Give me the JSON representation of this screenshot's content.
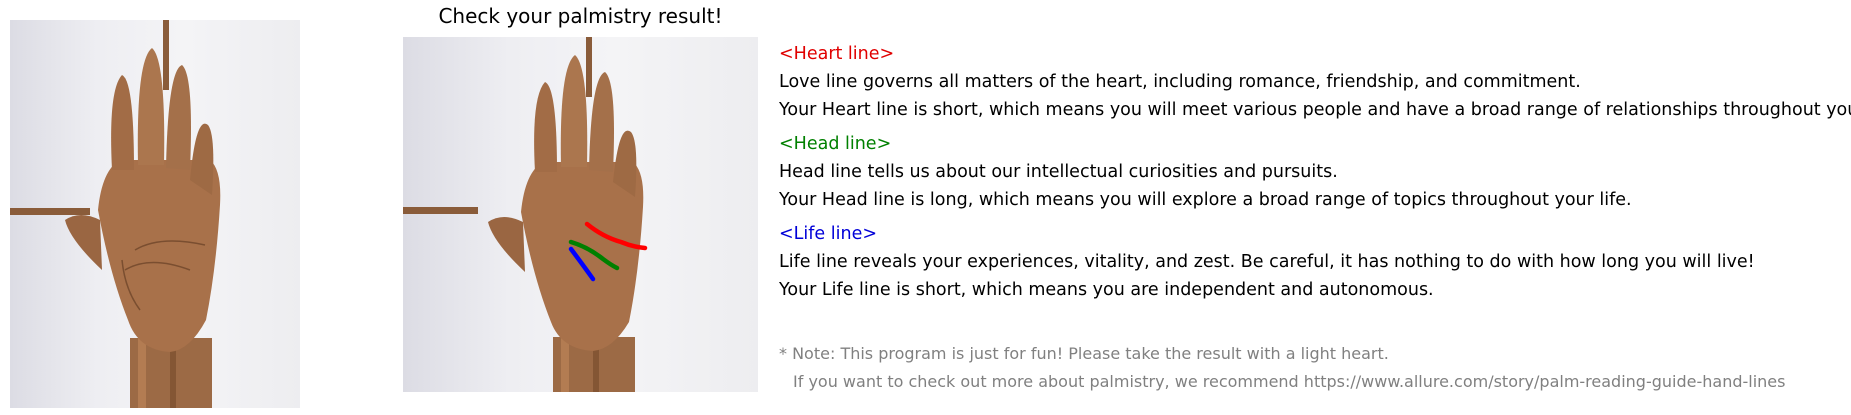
{
  "title": "Check your palmistry result!",
  "photos": {
    "original_alt": "hand-photo",
    "annotated_alt": "hand-photo-with-lines"
  },
  "sections": [
    {
      "heading": "<Heart line>",
      "color": "#e00000",
      "desc": "Love line governs all matters of the heart, including romance, friendship, and commitment.",
      "result": "Your Heart line is short, which means you will meet various people and have a broad range of relationships throughout your life."
    },
    {
      "heading": "<Head line>",
      "color": "#008000",
      "desc": "Head line tells us about our intellectual curiosities and pursuits.",
      "result": "Your Head line is long, which means you will explore a broad range of topics throughout your life."
    },
    {
      "heading": "<Life line>",
      "color": "#0000d8",
      "desc": "Life line reveals your experiences, vitality, and zest. Be careful, it has nothing to do with how long you will live!",
      "result": "Your Life line is short, which means you are independent and autonomous."
    }
  ],
  "note": {
    "line1": "* Note: This program is just for fun! Please take the result with a light heart.",
    "line2": "If you want to check out more about palmistry, we recommend https://www.allure.com/story/palm-reading-guide-hand-lines"
  }
}
